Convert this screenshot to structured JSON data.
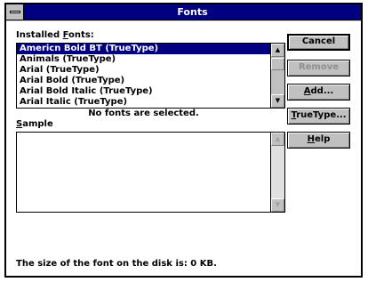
{
  "window": {
    "title": "Fonts"
  },
  "installed_fonts": {
    "label_prefix": "Installed ",
    "label_access": "F",
    "label_suffix": "onts:",
    "items": [
      "Americn Bold BT (TrueType)",
      "Animals (TrueType)",
      "Arial (TrueType)",
      "Arial Bold (TrueType)",
      "Arial Bold Italic (TrueType)",
      "Arial Italic (TrueType)"
    ],
    "selected_index": 0
  },
  "sample": {
    "label_access": "S",
    "label_suffix": "ample",
    "message": "No fonts are selected."
  },
  "status": {
    "text": "The size of the font on the disk is:  0 KB."
  },
  "buttons": {
    "cancel": "Cancel",
    "remove": "Remove",
    "add_access": "A",
    "add_rest": "dd...",
    "truetype_access": "T",
    "truetype_rest": "rueType...",
    "help_access": "H",
    "help_rest": "elp"
  },
  "icons": {
    "scroll_up": "▲",
    "scroll_down": "▼"
  },
  "colors": {
    "title_bar": "#000080",
    "selection": "#000080",
    "face": "#c0c0c0"
  }
}
